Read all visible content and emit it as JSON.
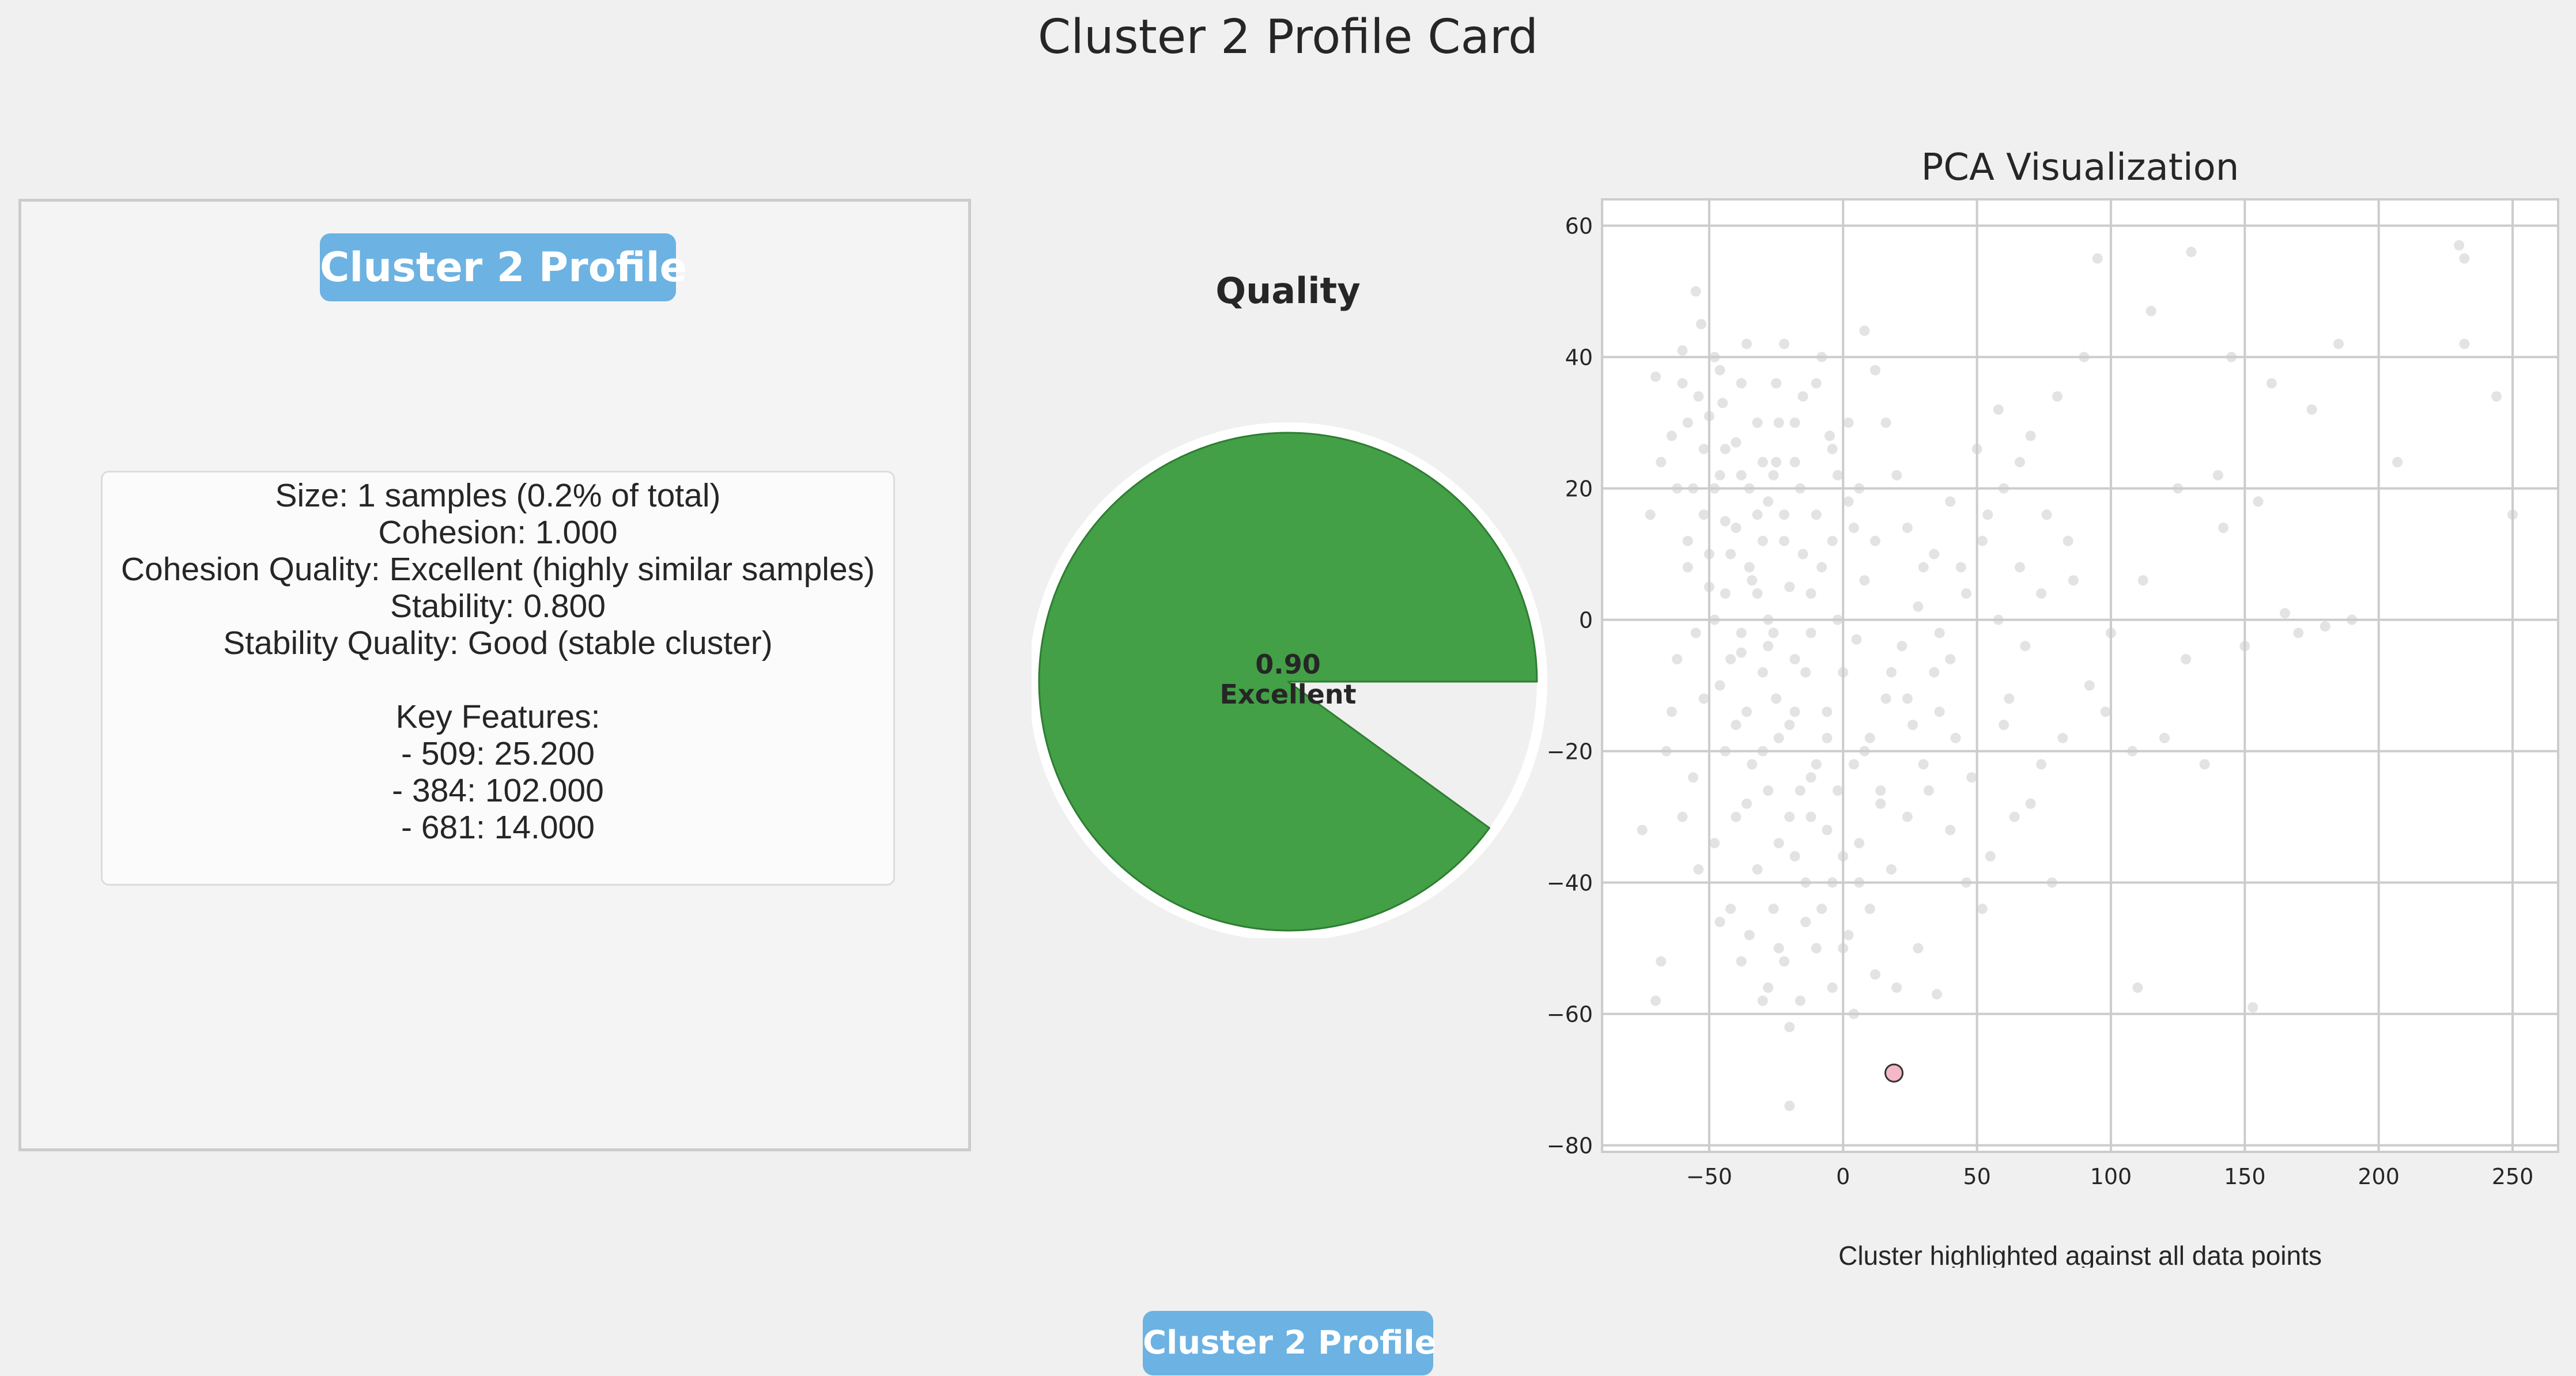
{
  "figure": {
    "suptitle": "Cluster 2 Profile Card",
    "footer_badge": "Cluster 2 Profile"
  },
  "profile_panel": {
    "badge": "Cluster 2 Profile",
    "lines": [
      "Size: 1 samples (0.2% of total)",
      "Cohesion: 1.000",
      "Cohesion Quality: Excellent (highly similar samples)",
      "Stability: 0.800",
      "Stability Quality: Good (stable cluster)"
    ],
    "features_header": "Key Features:",
    "features": [
      "- 509: 25.200",
      "- 384: 102.000",
      "- 681: 14.000"
    ]
  },
  "colors": {
    "background": "#f0f0f0",
    "badge": "#6cb2e2",
    "gauge_fill": "#43a047",
    "gauge_rest": "#f0f0f0",
    "background_points": "#cccccc",
    "highlight_point": "#f4b8c8",
    "grid": "#cccccc"
  },
  "chart_data": [
    {
      "type": "pie",
      "title": "Quality",
      "value": 0.9,
      "value_label": "0.90",
      "label": "Excellent",
      "slices": [
        {
          "name": "quality",
          "value": 0.9
        },
        {
          "name": "remainder",
          "value": 0.1
        }
      ]
    },
    {
      "type": "scatter",
      "title": "PCA Visualization",
      "xlabel": "Cluster highlighted against all data points",
      "ylabel": "",
      "xlim": [
        -90,
        267
      ],
      "ylim": [
        -81,
        64
      ],
      "xticks": [
        -50,
        0,
        50,
        100,
        150,
        200,
        250
      ],
      "xtick_labels": [
        "−50",
        "0",
        "50",
        "100",
        "150",
        "200",
        "250"
      ],
      "yticks": [
        -80,
        -60,
        -40,
        -20,
        0,
        20,
        40,
        60
      ],
      "ytick_labels": [
        "−80",
        "−60",
        "−40",
        "−20",
        "0",
        "20",
        "40",
        "60"
      ],
      "grid": true,
      "series": [
        {
          "role": "all",
          "points": [
            [
              -70,
              37
            ],
            [
              -60,
              41
            ],
            [
              -55,
              50
            ],
            [
              -53,
              45
            ],
            [
              -48,
              40
            ],
            [
              -50,
              31
            ],
            [
              -45,
              33
            ],
            [
              -58,
              30
            ],
            [
              -52,
              26
            ],
            [
              -62,
              20
            ],
            [
              -40,
              27
            ],
            [
              -38,
              22
            ],
            [
              -35,
              20
            ],
            [
              -48,
              20
            ],
            [
              -44,
              15
            ],
            [
              -42,
              10
            ],
            [
              -30,
              12
            ],
            [
              -28,
              18
            ],
            [
              -25,
              24
            ],
            [
              -22,
              16
            ],
            [
              -35,
              8
            ],
            [
              -32,
              4
            ],
            [
              -28,
              0
            ],
            [
              -20,
              5
            ],
            [
              -15,
              10
            ],
            [
              -38,
              -5
            ],
            [
              -30,
              -8
            ],
            [
              -25,
              -12
            ],
            [
              -18,
              -6
            ],
            [
              -12,
              -2
            ],
            [
              -50,
              5
            ],
            [
              -55,
              -2
            ],
            [
              -46,
              -10
            ],
            [
              -40,
              -16
            ],
            [
              -34,
              -22
            ],
            [
              -28,
              -26
            ],
            [
              -20,
              -30
            ],
            [
              -10,
              -22
            ],
            [
              -6,
              -14
            ],
            [
              0,
              -8
            ],
            [
              5,
              -3
            ],
            [
              8,
              6
            ],
            [
              12,
              12
            ],
            [
              2,
              18
            ],
            [
              -5,
              28
            ],
            [
              -10,
              36
            ],
            [
              -22,
              42
            ],
            [
              -18,
              30
            ],
            [
              -2,
              22
            ],
            [
              4,
              14
            ],
            [
              10,
              -18
            ],
            [
              14,
              -26
            ],
            [
              6,
              -34
            ],
            [
              -4,
              -40
            ],
            [
              -14,
              -46
            ],
            [
              -22,
              -52
            ],
            [
              -28,
              -56
            ],
            [
              2,
              -48
            ],
            [
              10,
              -44
            ],
            [
              18,
              -38
            ],
            [
              24,
              -30
            ],
            [
              30,
              -22
            ],
            [
              36,
              -14
            ],
            [
              40,
              -6
            ],
            [
              46,
              4
            ],
            [
              52,
              12
            ],
            [
              60,
              20
            ],
            [
              70,
              28
            ],
            [
              80,
              34
            ],
            [
              90,
              40
            ],
            [
              95,
              55
            ],
            [
              115,
              47
            ],
            [
              130,
              56
            ],
            [
              145,
              40
            ],
            [
              160,
              36
            ],
            [
              175,
              32
            ],
            [
              185,
              42
            ],
            [
              207,
              24
            ],
            [
              230,
              57
            ],
            [
              232,
              55
            ],
            [
              244,
              34
            ],
            [
              250,
              16
            ],
            [
              232,
              42
            ],
            [
              190,
              0
            ],
            [
              180,
              -1
            ],
            [
              165,
              1
            ],
            [
              155,
              18
            ],
            [
              140,
              22
            ],
            [
              125,
              20
            ],
            [
              112,
              6
            ],
            [
              100,
              -2
            ],
            [
              92,
              -10
            ],
            [
              82,
              -18
            ],
            [
              74,
              -22
            ],
            [
              64,
              -30
            ],
            [
              55,
              -36
            ],
            [
              48,
              -24
            ],
            [
              42,
              -18
            ],
            [
              36,
              -2
            ],
            [
              30,
              8
            ],
            [
              24,
              14
            ],
            [
              20,
              22
            ],
            [
              16,
              30
            ],
            [
              12,
              38
            ],
            [
              8,
              44
            ],
            [
              -8,
              40
            ],
            [
              -15,
              34
            ],
            [
              -25,
              36
            ],
            [
              -32,
              30
            ],
            [
              -38,
              36
            ],
            [
              -44,
              26
            ],
            [
              -54,
              34
            ],
            [
              -64,
              28
            ],
            [
              -68,
              24
            ],
            [
              -72,
              16
            ],
            [
              -58,
              12
            ],
            [
              -48,
              0
            ],
            [
              -42,
              -6
            ],
            [
              -36,
              -14
            ],
            [
              -30,
              -20
            ],
            [
              -24,
              -18
            ],
            [
              -18,
              -14
            ],
            [
              -12,
              -24
            ],
            [
              -6,
              -32
            ],
            [
              0,
              -36
            ],
            [
              6,
              -40
            ],
            [
              -16,
              -58
            ],
            [
              -20,
              -62
            ],
            [
              -35,
              -48
            ],
            [
              -42,
              -44
            ],
            [
              -68,
              -52
            ],
            [
              -70,
              -58
            ],
            [
              -75,
              -32
            ],
            [
              -64,
              -14
            ],
            [
              -56,
              -24
            ],
            [
              -48,
              -34
            ],
            [
              -40,
              -30
            ],
            [
              -32,
              -38
            ],
            [
              -26,
              -44
            ],
            [
              -18,
              -36
            ],
            [
              -10,
              -50
            ],
            [
              -4,
              -56
            ],
            [
              4,
              -60
            ],
            [
              12,
              -54
            ],
            [
              20,
              -56
            ],
            [
              28,
              -50
            ],
            [
              35,
              -57
            ],
            [
              -20,
              -74
            ],
            [
              110,
              -56
            ],
            [
              153,
              -59
            ],
            [
              78,
              -40
            ],
            [
              70,
              -28
            ],
            [
              62,
              -12
            ],
            [
              58,
              0
            ],
            [
              66,
              8
            ],
            [
              76,
              16
            ],
            [
              86,
              6
            ],
            [
              98,
              -14
            ],
            [
              108,
              -20
            ],
            [
              120,
              -18
            ],
            [
              135,
              -22
            ],
            [
              128,
              -6
            ],
            [
              142,
              14
            ],
            [
              150,
              -4
            ],
            [
              170,
              -2
            ],
            [
              -60,
              36
            ],
            [
              -46,
              38
            ],
            [
              -36,
              42
            ],
            [
              -26,
              22
            ],
            [
              -16,
              20
            ],
            [
              -8,
              8
            ],
            [
              -2,
              0
            ],
            [
              -14,
              -8
            ],
            [
              -20,
              -16
            ],
            [
              -28,
              -4
            ],
            [
              -34,
              6
            ],
            [
              -40,
              14
            ],
            [
              -46,
              22
            ],
            [
              -52,
              16
            ],
            [
              -58,
              8
            ],
            [
              -62,
              -6
            ],
            [
              -52,
              -12
            ],
            [
              -44,
              -20
            ],
            [
              -36,
              -28
            ],
            [
              -24,
              -34
            ],
            [
              -12,
              -30
            ],
            [
              -2,
              -26
            ],
            [
              8,
              -20
            ],
            [
              16,
              -12
            ],
            [
              22,
              -4
            ],
            [
              28,
              2
            ],
            [
              34,
              10
            ],
            [
              40,
              18
            ],
            [
              50,
              26
            ],
            [
              58,
              32
            ],
            [
              66,
              24
            ],
            [
              54,
              16
            ],
            [
              44,
              8
            ],
            [
              34,
              -8
            ],
            [
              26,
              -16
            ],
            [
              14,
              -28
            ],
            [
              4,
              -22
            ],
            [
              -6,
              -18
            ],
            [
              -16,
              -26
            ],
            [
              -26,
              -2
            ],
            [
              -32,
              16
            ],
            [
              -22,
              12
            ],
            [
              -12,
              4
            ],
            [
              -4,
              12
            ],
            [
              6,
              20
            ],
            [
              -56,
              20
            ],
            [
              -50,
              10
            ],
            [
              -44,
              4
            ],
            [
              -38,
              -2
            ],
            [
              -30,
              24
            ],
            [
              -24,
              30
            ],
            [
              -18,
              24
            ],
            [
              -10,
              16
            ],
            [
              -4,
              26
            ],
            [
              2,
              30
            ],
            [
              -66,
              -20
            ],
            [
              -60,
              -30
            ],
            [
              -54,
              -38
            ],
            [
              -46,
              -46
            ],
            [
              -38,
              -52
            ],
            [
              -30,
              -58
            ],
            [
              -24,
              -50
            ],
            [
              -14,
              -40
            ],
            [
              -8,
              -44
            ],
            [
              0,
              -50
            ],
            [
              18,
              -8
            ],
            [
              24,
              -12
            ],
            [
              32,
              -26
            ],
            [
              40,
              -32
            ],
            [
              46,
              -40
            ],
            [
              52,
              -44
            ],
            [
              60,
              -16
            ],
            [
              68,
              -4
            ],
            [
              74,
              4
            ],
            [
              84,
              12
            ]
          ]
        },
        {
          "role": "cluster",
          "points": [
            [
              19,
              -69
            ]
          ]
        }
      ]
    }
  ]
}
